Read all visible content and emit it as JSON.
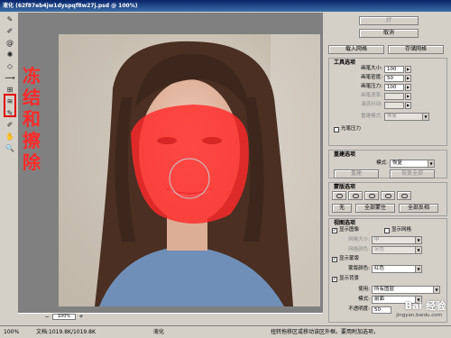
{
  "window": {
    "title": "液化 (62f87eb4jw1dyspqf8w27j.psd @ 100%)"
  },
  "overlay": {
    "annotation_text": "冻结和擦除"
  },
  "tools": [
    {
      "icon": "forward-warp-icon",
      "glyph": "✎"
    },
    {
      "icon": "reconstruct-icon",
      "glyph": "✐"
    },
    {
      "icon": "twirl-icon",
      "glyph": "@"
    },
    {
      "icon": "pucker-icon",
      "glyph": "✺"
    },
    {
      "icon": "bloat-icon",
      "glyph": "◇"
    },
    {
      "icon": "push-left-icon",
      "glyph": "⟿"
    },
    {
      "icon": "mirror-icon",
      "glyph": "⊞"
    },
    {
      "icon": "turbulence-icon",
      "glyph": "≋"
    },
    {
      "icon": "freeze-mask-icon",
      "glyph": "✎"
    },
    {
      "icon": "thaw-mask-icon",
      "glyph": "✐"
    },
    {
      "icon": "hand-icon",
      "glyph": "✋"
    },
    {
      "icon": "zoom-icon",
      "glyph": "🔍"
    }
  ],
  "canvas": {
    "zoom": "100%",
    "minus": "−",
    "plus": "+"
  },
  "panel": {
    "ok": "好",
    "cancel": "取消",
    "load_mesh": "载入网格",
    "save_mesh": "存储网格",
    "tool_options": {
      "title": "工具选项",
      "brush_size_label": "画笔大小:",
      "brush_size": "100",
      "brush_density_label": "画笔密度:",
      "brush_density": "50",
      "brush_pressure_label": "画笔压力:",
      "brush_pressure": "100",
      "brush_rate_label": "画笔速率:",
      "turbulent_jitter_label": "湍流抖动:",
      "reconstruct_mode_label": "重建模式:",
      "reconstruct_mode": "恢复",
      "stylus_pressure": "光笔压力"
    },
    "reconstruct_options": {
      "title": "重建选项",
      "mode_label": "模式:",
      "mode": "恢复",
      "reconstruct_btn": "重建",
      "restore_all_btn": "恢复全部"
    },
    "mask_options": {
      "title": "蒙版选项",
      "none": "无",
      "mask_all": "全部蒙住",
      "invert_all": "全部反相"
    },
    "view_options": {
      "title": "视图选项",
      "show_image": "显示图像",
      "show_mesh": "显示网格",
      "mesh_size_label": "网格大小:",
      "mesh_size": "中",
      "mesh_color_label": "网格颜色:",
      "mesh_color": "灰色",
      "show_mask": "显示蒙版",
      "mask_color_label": "蒙版颜色:",
      "mask_color": "红色",
      "show_backdrop": "显示背景",
      "use_label": "使用:",
      "use": "所有图层",
      "mode_label": "模式:",
      "mode": "前面",
      "opacity_label": "不透明度:",
      "opacity": "50"
    }
  },
  "status": {
    "zoom": "100%",
    "doc": "文档:1019.8K/1019.8K",
    "tool": "液化",
    "hint": "扭转拖移区或移动该区外框。要用附加选项，"
  },
  "watermark": {
    "main": "Bai 经验",
    "sub": "jingyan.baidu.com"
  },
  "colors": {
    "mask": "#ff2a2a",
    "title_bar": "#0a246a",
    "annotation": "#ff2a2a"
  }
}
